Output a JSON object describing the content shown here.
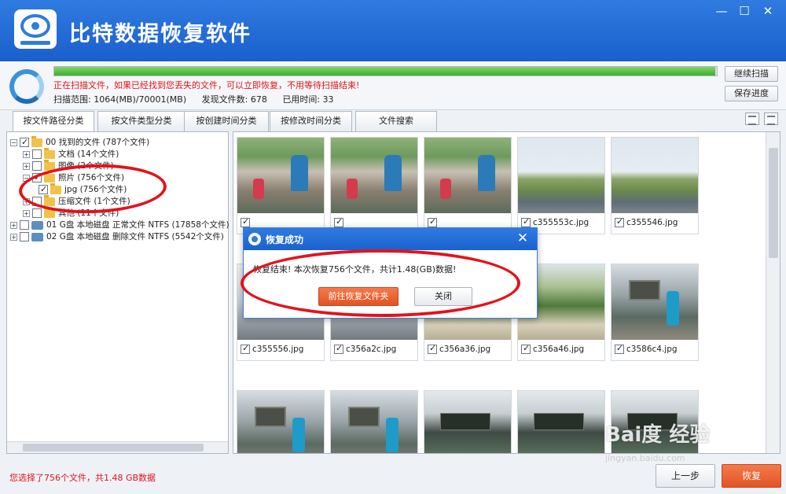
{
  "window": {
    "title": "比特数据恢复软件",
    "min_glyph": "—",
    "max_glyph": "☐",
    "close_glyph": "✕"
  },
  "scan": {
    "progress": 0.998,
    "message": "正在扫描文件，如果已经找到您丢失的文件，可以立即恢复，不用等待扫描结束!",
    "range": "扫描范围: 1064(MB)/70001(MB)",
    "found": "发现文件数: 678",
    "elapsed": "已用时间: 33",
    "continue_label": "继续扫描",
    "save_label": "保存进度"
  },
  "tabs": [
    "按文件路径分类",
    "按文件类型分类",
    "按创建时间分类",
    "按修改时间分类",
    "文件搜索"
  ],
  "tree": [
    {
      "label": "00 找到的文件  (787个文件)",
      "expander": "−",
      "checked": true,
      "icon": "folder-icon"
    },
    {
      "label": "文档     (14个文件)",
      "expander": "+",
      "checked": false,
      "icon": "folder-icon"
    },
    {
      "label": "图像     (2个文件)",
      "expander": "+",
      "checked": false,
      "icon": "folder-icon"
    },
    {
      "label": "照片     (756个文件)",
      "expander": "−",
      "checked": true,
      "icon": "folder-icon"
    },
    {
      "label": "jpg     (756个文件)",
      "expander": "",
      "checked": true,
      "icon": "folder-icon"
    },
    {
      "label": "压缩文件   (1个文件)",
      "expander": "+",
      "checked": false,
      "icon": "folder-icon"
    },
    {
      "label": "其他     (11个文件)",
      "expander": "+",
      "checked": false,
      "icon": "folder-icon"
    },
    {
      "label": "01 G盘 本地磁盘 正常文件 NTFS  (17858个文件)",
      "expander": "+",
      "checked": false,
      "icon": "drive-icon"
    },
    {
      "label": "02 G盘 本地磁盘 删除文件 NTFS  (5542个文件)",
      "expander": "+",
      "checked": false,
      "icon": "drive-icon"
    }
  ],
  "files": [
    {
      "name": "",
      "checked": true,
      "photo": "rocks"
    },
    {
      "name": "",
      "checked": true,
      "photo": "rocks"
    },
    {
      "name": "",
      "checked": true,
      "photo": "rocks"
    },
    {
      "name": "c355553c.jpg",
      "checked": true,
      "photo": "park"
    },
    {
      "name": "c355546.jpg",
      "checked": true,
      "photo": "park"
    },
    {
      "name": "c355556.jpg",
      "checked": true,
      "photo": "road"
    },
    {
      "name": "c356a2c.jpg",
      "checked": true,
      "photo": "road"
    },
    {
      "name": "c356a36.jpg",
      "checked": true,
      "photo": "crowd"
    },
    {
      "name": "c356a46.jpg",
      "checked": true,
      "photo": "crowd"
    },
    {
      "name": "c3586c4.jpg",
      "checked": true,
      "photo": "gate"
    },
    {
      "name": "",
      "checked": false,
      "photo": "gate"
    },
    {
      "name": "",
      "checked": false,
      "photo": "gate"
    },
    {
      "name": "",
      "checked": false,
      "photo": "dark"
    },
    {
      "name": "",
      "checked": false,
      "photo": "dark"
    },
    {
      "name": "",
      "checked": false,
      "photo": "dark"
    }
  ],
  "dialog": {
    "title": "恢复成功",
    "close_glyph": "✕",
    "message": "恢复结束! 本次恢复756个文件，共计1.48(GB)数据!",
    "goto_label": "前往恢复文件夹",
    "close_label": "关闭"
  },
  "footer": {
    "status": "您选择了756个文件，共1.48 GB数据",
    "prev_label": "上一步",
    "recover_label": "恢复"
  },
  "watermark": {
    "brand": "Bai度 经验",
    "url": "jingyan.baidu.com"
  },
  "colors": {
    "titlebar": "#2f7be0",
    "accent_orange": "#e05426",
    "alert_red": "#e0141a",
    "annotation_red": "#e2131c"
  }
}
